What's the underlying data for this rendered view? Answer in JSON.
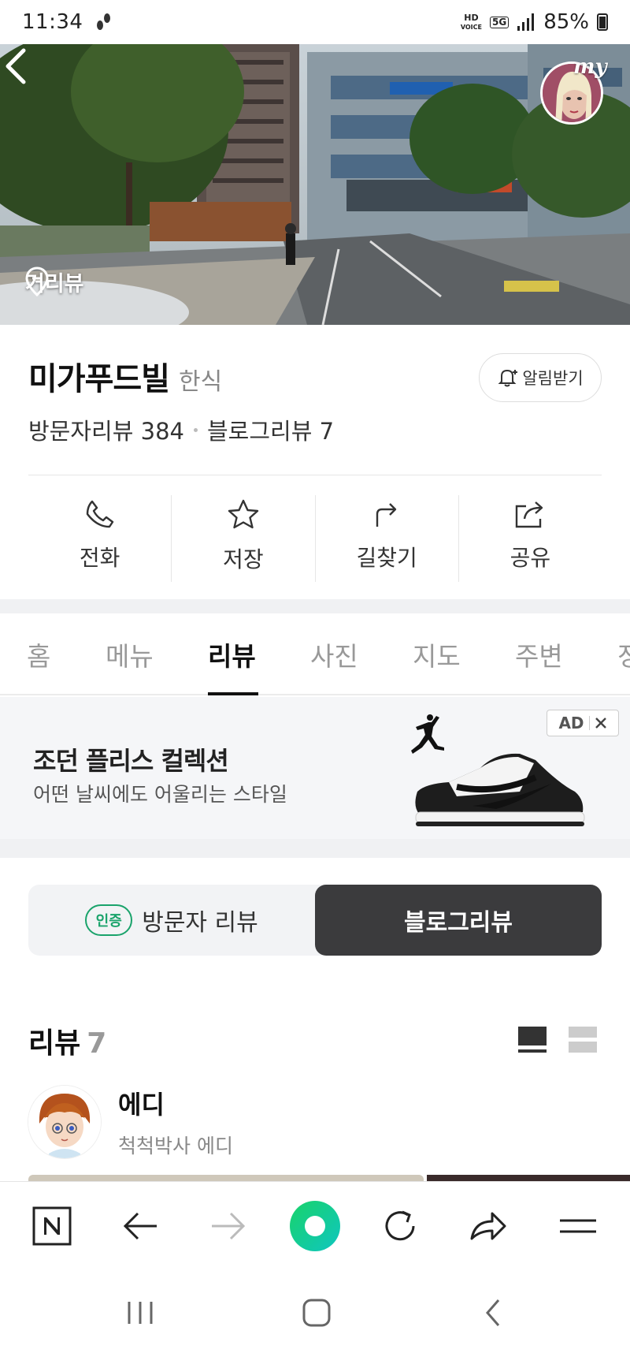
{
  "status_bar": {
    "time": "11:34",
    "hd": "HD",
    "voice": "VOICE",
    "net": "5G",
    "battery": "85%"
  },
  "hero": {
    "streetview_label": "거리뷰",
    "my_label": "my"
  },
  "place": {
    "name": "미가푸드빌",
    "category": "한식",
    "alarm_label": "알림받기",
    "visitor_reviews": "방문자리뷰 384",
    "blog_reviews": "블로그리뷰 7"
  },
  "actions": [
    {
      "label": "전화",
      "icon": "phone-icon"
    },
    {
      "label": "저장",
      "icon": "star-icon"
    },
    {
      "label": "길찾기",
      "icon": "directions-icon"
    },
    {
      "label": "공유",
      "icon": "share-icon"
    }
  ],
  "tabs": [
    {
      "label": "홈"
    },
    {
      "label": "메뉴"
    },
    {
      "label": "리뷰",
      "active": true
    },
    {
      "label": "사진"
    },
    {
      "label": "지도"
    },
    {
      "label": "주변"
    },
    {
      "label": "정"
    }
  ],
  "ad": {
    "title": "조던 플리스 컬렉션",
    "subtitle": "어떤 날씨에도 어울리는 스타일",
    "badge": "AD"
  },
  "segment": {
    "cert_label": "인증",
    "visitor": "방문자 리뷰",
    "blog": "블로그리뷰"
  },
  "reviews": {
    "heading": "리뷰",
    "count": "7"
  },
  "author": {
    "name": "에디",
    "title": "척척박사 에디"
  },
  "colors": {
    "accent_green": "#1aa36b",
    "browser_green": "#03c75a",
    "dark_segment": "#3b3b3d"
  }
}
